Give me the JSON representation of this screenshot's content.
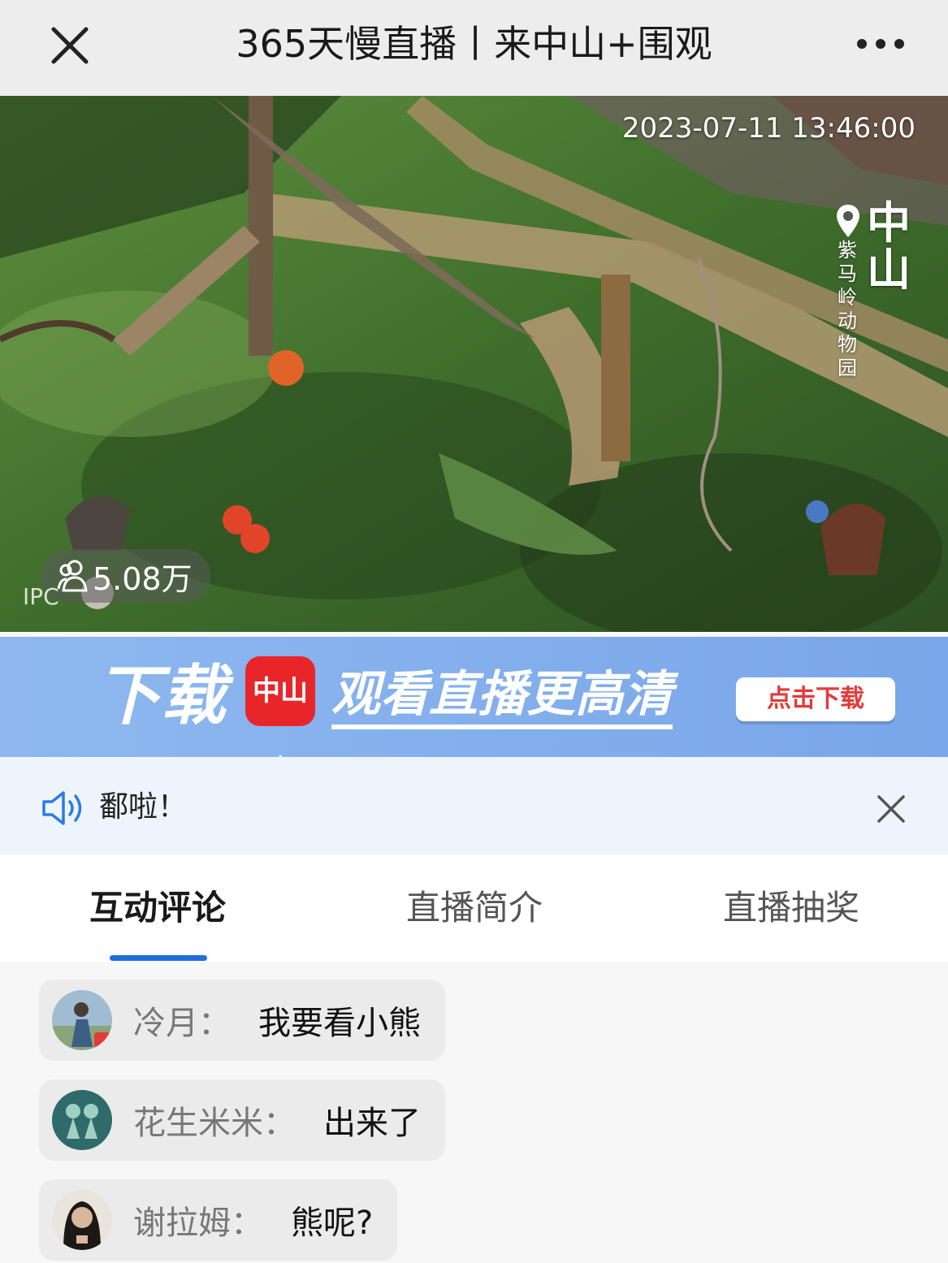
{
  "header": {
    "title": "365天慢直播丨来中山+围观",
    "close_icon": "close-icon",
    "more_icon": "more-dots-icon"
  },
  "video": {
    "timestamp": "2023-07-11 13:46:00",
    "location_city": "中山",
    "location_place": "紫马岭动物园",
    "viewers": "5.08万",
    "camera_label": "IPC"
  },
  "banner": {
    "download": "下载",
    "app_name": "中山",
    "app_plus": "+",
    "slogan": "观看直播更高清",
    "button": "点击下载"
  },
  "notice": {
    "text": "鄱啦！",
    "speaker_icon": "speaker-icon",
    "close_icon": "close-icon"
  },
  "tabs": [
    {
      "label": "互动评论",
      "active": true
    },
    {
      "label": "直播简介",
      "active": false
    },
    {
      "label": "直播抽奖",
      "active": false
    }
  ],
  "comments": [
    {
      "name": "冷月：",
      "text": "我要看小熊"
    },
    {
      "name": "花生米米：",
      "text": "出来了"
    },
    {
      "name": "谢拉姆：",
      "text": "熊呢?"
    }
  ],
  "colors": {
    "accent": "#1e6fdb",
    "banner": "#82aeed",
    "app_red": "#e8262a"
  }
}
